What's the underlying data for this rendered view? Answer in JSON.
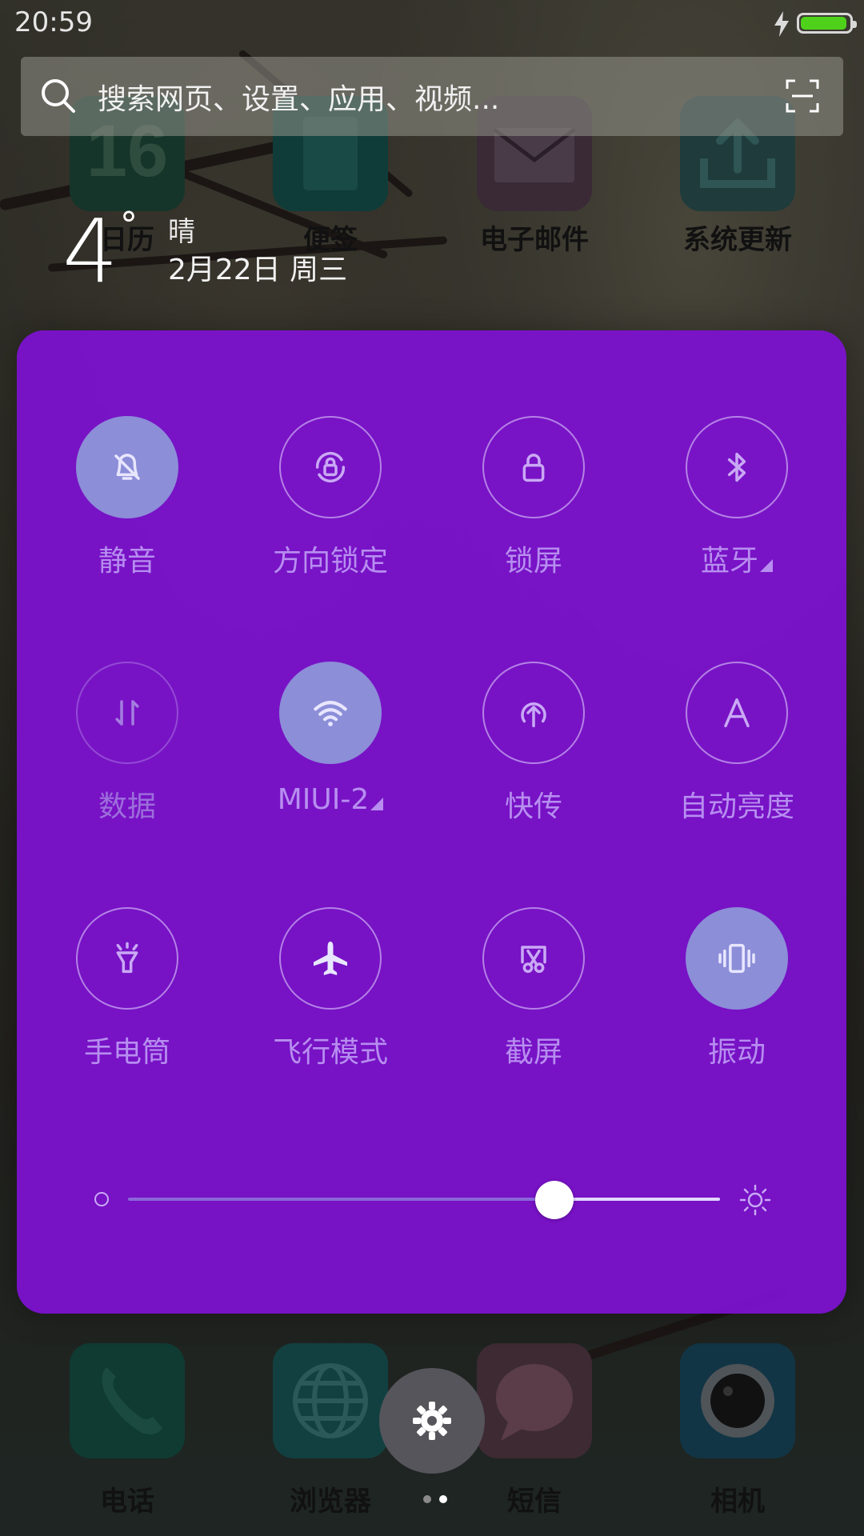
{
  "status_bar": {
    "time": "20:59",
    "battery_color": "#4fd11c",
    "battery_level": 0.95
  },
  "search": {
    "placeholder": "搜索网页、设置、应用、视频..."
  },
  "weather": {
    "temperature": "4",
    "condition": "晴",
    "date": "2月22日 周三"
  },
  "home_apps": [
    {
      "label": "日历",
      "icon": "calendar-icon",
      "color": "#16352a",
      "badge": "16"
    },
    {
      "label": "便签",
      "icon": "notes-icon",
      "color": "#0f3c39"
    },
    {
      "label": "电子邮件",
      "icon": "email-icon",
      "color": "#3a2a36"
    },
    {
      "label": "系统更新",
      "icon": "update-icon",
      "color": "#1f3b3b"
    }
  ],
  "dock_apps": [
    {
      "label": "电话",
      "icon": "phone-icon",
      "color": "#0f3b33"
    },
    {
      "label": "浏览器",
      "icon": "browser-icon",
      "color": "#124040"
    },
    {
      "label": "短信",
      "icon": "sms-icon",
      "color": "#3d2a33"
    },
    {
      "label": "相机",
      "icon": "camera-icon",
      "color": "#123545"
    }
  ],
  "toggles": [
    {
      "label": "静音",
      "icon": "bell-off-icon",
      "on": true
    },
    {
      "label": "方向锁定",
      "icon": "rotation-lock-icon",
      "on": false
    },
    {
      "label": "锁屏",
      "icon": "lock-icon",
      "on": false
    },
    {
      "label": "蓝牙",
      "icon": "bluetooth-icon",
      "on": false,
      "more": true
    },
    {
      "label": "数据",
      "icon": "data-icon",
      "on": false,
      "disabled": true
    },
    {
      "label": "MIUI-2",
      "icon": "wifi-icon",
      "on": true,
      "more": true
    },
    {
      "label": "快传",
      "icon": "quick-transfer-icon",
      "on": false
    },
    {
      "label": "自动亮度",
      "icon": "auto-brightness-icon",
      "on": false
    },
    {
      "label": "手电筒",
      "icon": "flashlight-icon",
      "on": false
    },
    {
      "label": "飞行模式",
      "icon": "airplane-icon",
      "on": false
    },
    {
      "label": "截屏",
      "icon": "screenshot-icon",
      "on": false
    },
    {
      "label": "振动",
      "icon": "vibrate-icon",
      "on": true
    }
  ],
  "brightness": {
    "level": 0.72
  },
  "colors": {
    "panel": "#7e11d2",
    "toggle_on": "#8c8ed8",
    "label": "#b78ef0"
  },
  "pages": {
    "count": 2,
    "current": 2
  }
}
